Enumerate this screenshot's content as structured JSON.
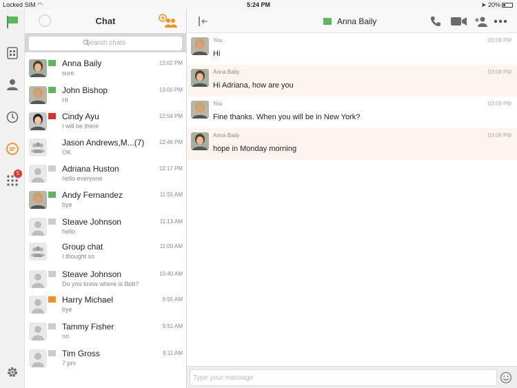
{
  "status_bar": {
    "carrier": "Locked SIM",
    "time": "5:24 PM",
    "battery": "20%"
  },
  "sidebar": {
    "dialpad_badge": "5"
  },
  "chat_list": {
    "title": "Chat",
    "search_placeholder": "Search chats",
    "items": [
      {
        "name": "Anna Baily",
        "preview": "sure",
        "time": "13:02 PM",
        "flag": "#5cb85c",
        "avatar": "photo"
      },
      {
        "name": "John Bishop",
        "preview": "Hi",
        "time": "13:00 PM",
        "flag": "#5cb85c",
        "avatar": "photo"
      },
      {
        "name": "Cindy Ayu",
        "preview": "I will be there",
        "time": "12:54 PM",
        "flag": "#d9302c",
        "avatar": "photo"
      },
      {
        "name": "Jason Andrews,M...(7)",
        "preview": "OK",
        "time": "12:46 PM",
        "flag": "",
        "avatar": "group"
      },
      {
        "name": "Adriana Huston",
        "preview": "hello everyone",
        "time": "12:17 PM",
        "flag": "#cccccc",
        "avatar": "person"
      },
      {
        "name": "Andy Fernandez",
        "preview": "bye",
        "time": "11:55 AM",
        "flag": "#5cb85c",
        "avatar": "photo"
      },
      {
        "name": "Steave Johnson",
        "preview": "hello",
        "time": "11:13 AM",
        "flag": "#cccccc",
        "avatar": "person"
      },
      {
        "name": "Group chat",
        "preview": "I thought so",
        "time": "11:00 AM",
        "flag": "",
        "avatar": "group"
      },
      {
        "name": "Steave Johnson",
        "preview": "Do you know where is Bob?",
        "time": "10:40 AM",
        "flag": "#cccccc",
        "avatar": "person"
      },
      {
        "name": "Harry Michael",
        "preview": "bye",
        "time": "9:55 AM",
        "flag": "#f0901f",
        "avatar": "person"
      },
      {
        "name": "Tammy Fisher",
        "preview": "no",
        "time": "9:51 AM",
        "flag": "#cccccc",
        "avatar": "person"
      },
      {
        "name": "Tim Gross",
        "preview": "7 pm",
        "time": "9:11 AM",
        "flag": "#cccccc",
        "avatar": "person"
      }
    ]
  },
  "conversation": {
    "contact_name": "Anna Baily",
    "contact_flag": "#5cb85c",
    "messages": [
      {
        "sender": "You",
        "text": "Hi",
        "time": "03:08 PM",
        "mine": true
      },
      {
        "sender": "Anna Baily",
        "text": "Hi Adriana, how are you",
        "time": "03:08 PM",
        "mine": false
      },
      {
        "sender": "You",
        "text": "Fine thanks. When you will be in New York?",
        "time": "03:09 PM",
        "mine": true
      },
      {
        "sender": "Anna Baily",
        "text": "hope in Monday morning",
        "time": "03:09 PM",
        "mine": false
      }
    ],
    "composer_placeholder": "Type your message"
  },
  "colors": {
    "accent": "#f0901f",
    "green": "#5cb85c",
    "icon_gray": "#6b6b6b"
  }
}
